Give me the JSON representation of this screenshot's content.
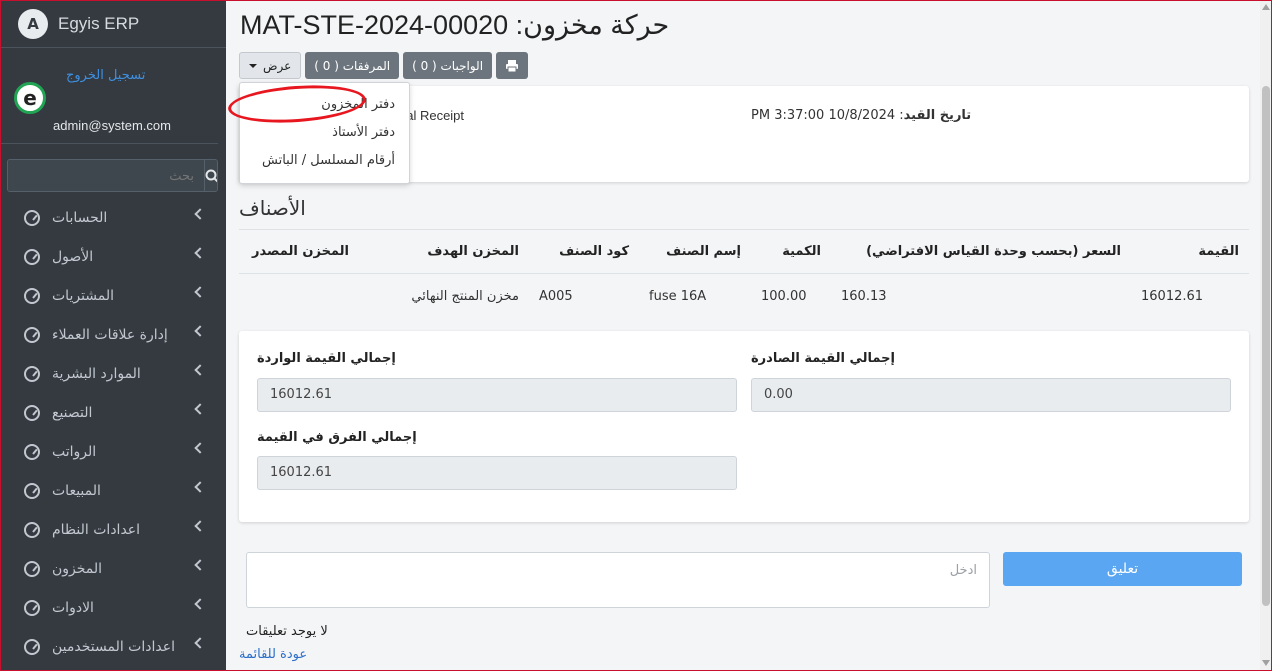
{
  "app": {
    "brand": "Egyis ERP",
    "logo_letter": "A"
  },
  "user": {
    "email": "admin@system.com",
    "logout": "تسجيل الخروج",
    "avatar_letter": "e"
  },
  "search": {
    "placeholder": "بحث"
  },
  "nav": {
    "items": [
      {
        "label": "الحسابات"
      },
      {
        "label": "الأصول"
      },
      {
        "label": "المشتريات"
      },
      {
        "label": "إدارة علاقات العملاء"
      },
      {
        "label": "الموارد البشرية"
      },
      {
        "label": "التصنيع"
      },
      {
        "label": "الرواتب"
      },
      {
        "label": "المبيعات"
      },
      {
        "label": "اعدادات النظام"
      },
      {
        "label": "المخزون"
      },
      {
        "label": "الادوات"
      },
      {
        "label": "اعدادات المستخدمين"
      }
    ]
  },
  "page": {
    "title": "حركة مخزون: MAT-STE-2024-00020"
  },
  "toolbar": {
    "view_label": "عرض",
    "attachments_label": "المرفقات ( 0 )",
    "duties_label": "الواجبات ( 0 )"
  },
  "dropdown": {
    "items": [
      {
        "label": "دفتر المخزون"
      },
      {
        "label": "دفتر الأستاذ"
      },
      {
        "label": "أرقام المسلسل / الباتش"
      }
    ]
  },
  "info": {
    "purpose_partial": "rial Receipt",
    "second_partial": "l",
    "date_label": "تاريخ القيد",
    "date_value": "10/8/2024 3:37:00 PM"
  },
  "items": {
    "title": "الأصناف",
    "headers": [
      "القيمة",
      "السعر (بحسب وحدة القياس الافتراضي)",
      "الكمية",
      "إسم الصنف",
      "كود الصنف",
      "المخزن الهدف",
      "المخزن المصدر"
    ],
    "rows": [
      [
        "16012.61",
        "160.13",
        "100.00",
        "fuse 16A",
        "A005",
        "مخزن المنتج النهائي",
        ""
      ]
    ]
  },
  "totals": {
    "outgoing_label": "إجمالي القيمة الصادرة",
    "outgoing_value": "0.00",
    "incoming_label": "إجمالي القيمة الواردة",
    "incoming_value": "16012.61",
    "diff_label": "إجمالي الفرق في القيمة",
    "diff_value": "16012.61"
  },
  "comments": {
    "placeholder": "ادخل",
    "button": "تعليق",
    "empty": "لا يوجد تعليقات",
    "back": "عودة للقائمة"
  },
  "colors": {
    "sidebar_bg": "#343a40",
    "accent": "#5aa6f2",
    "highlight": "#e8161e"
  }
}
